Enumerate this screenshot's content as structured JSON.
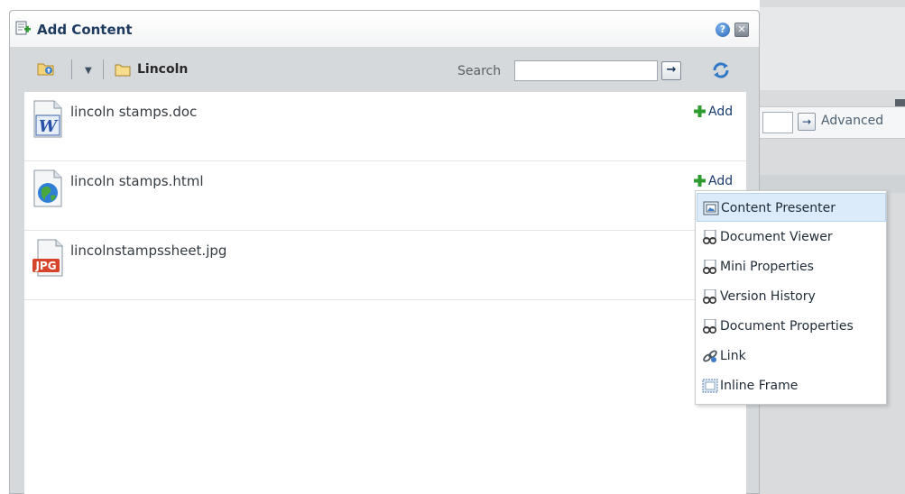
{
  "dialog": {
    "title": "Add Content",
    "help_icon": "help-icon",
    "close_icon": "close-icon"
  },
  "toolbar": {
    "breadcrumb": "Lincoln",
    "search_label": "Search",
    "search_value": "",
    "go_symbol": "→"
  },
  "files": [
    {
      "name": "lincoln stamps.doc",
      "icon": "word-document-icon",
      "add_label": "Add"
    },
    {
      "name": "lincoln stamps.html",
      "icon": "html-globe-icon",
      "add_label": "Add"
    },
    {
      "name": "lincolnstampssheet.jpg",
      "icon": "jpg-image-icon",
      "add_label": ""
    }
  ],
  "menu": {
    "items": [
      {
        "label": "Content Presenter",
        "icon": "content-presenter-icon",
        "selected": true
      },
      {
        "label": "Document Viewer",
        "icon": "document-viewer-icon"
      },
      {
        "label": "Mini Properties",
        "icon": "mini-properties-icon"
      },
      {
        "label": "Version History",
        "icon": "version-history-icon"
      },
      {
        "label": "Document Properties",
        "icon": "document-properties-icon"
      },
      {
        "label": "Link",
        "icon": "link-icon"
      },
      {
        "label": "Inline Frame",
        "icon": "inline-frame-icon"
      }
    ]
  },
  "background": {
    "advanced_label": "Advanced"
  },
  "colors": {
    "title": "#1d3b5e",
    "link": "#1a3c6e",
    "menu_selected": "#dcebfa",
    "dialog_bg": "#d6d9dc"
  }
}
